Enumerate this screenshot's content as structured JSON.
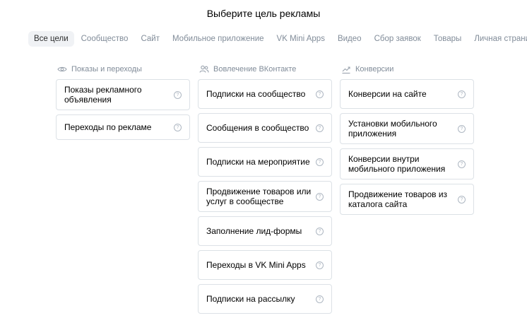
{
  "header": {
    "title": "Выберите цель рекламы"
  },
  "tabs": [
    {
      "label": "Все цели",
      "active": true
    },
    {
      "label": "Сообщество",
      "active": false
    },
    {
      "label": "Сайт",
      "active": false
    },
    {
      "label": "Мобильное приложение",
      "active": false
    },
    {
      "label": "VK Mini Apps",
      "active": false
    },
    {
      "label": "Видео",
      "active": false
    },
    {
      "label": "Сбор заявок",
      "active": false
    },
    {
      "label": "Товары",
      "active": false
    },
    {
      "label": "Личная страница",
      "active": false
    }
  ],
  "columns": [
    {
      "title": "Показы и переходы",
      "icon": "eye-icon",
      "items": [
        {
          "label": "Показы рекламного объявления"
        },
        {
          "label": "Переходы по рекламе"
        }
      ]
    },
    {
      "title": "Вовлечение ВКонтакте",
      "icon": "users-icon",
      "items": [
        {
          "label": "Подписки на сообщество"
        },
        {
          "label": "Сообщения в сообщество"
        },
        {
          "label": "Подписки на мероприятие"
        },
        {
          "label": "Продвижение товаров или услуг в сообществе"
        },
        {
          "label": "Заполнение лид-формы"
        },
        {
          "label": "Переходы в VK Mini Apps"
        },
        {
          "label": "Подписки на рассылку"
        }
      ]
    },
    {
      "title": "Конверсии",
      "icon": "trend-up-icon",
      "items": [
        {
          "label": "Конверсии на сайте"
        },
        {
          "label": "Установки мобильного приложения"
        },
        {
          "label": "Конверсии внутри мобильного приложения"
        },
        {
          "label": "Продвижение товаров из каталога сайта"
        }
      ]
    }
  ],
  "help_glyph": "?",
  "colors": {
    "muted": "#818c99",
    "border": "#dce1e6",
    "active_tab_bg": "#f0f2f5"
  }
}
